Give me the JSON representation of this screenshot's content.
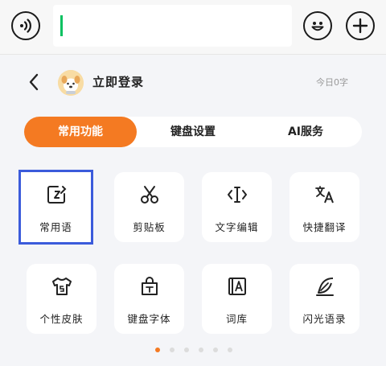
{
  "input": {
    "value": ""
  },
  "header": {
    "login_label": "立即登录",
    "today_count": "今日0字"
  },
  "tabs": [
    {
      "label": "常用功能",
      "active": true
    },
    {
      "label": "键盘设置",
      "active": false
    },
    {
      "label": "AI服务",
      "active": false
    }
  ],
  "features": [
    {
      "label": "常用语",
      "icon": "edit-note-icon",
      "selected": true
    },
    {
      "label": "剪贴板",
      "icon": "scissors-icon",
      "selected": false
    },
    {
      "label": "文字编辑",
      "icon": "text-cursor-icon",
      "selected": false
    },
    {
      "label": "快捷翻译",
      "icon": "translate-icon",
      "selected": false
    },
    {
      "label": "个性皮肤",
      "icon": "tshirt-icon",
      "selected": false
    },
    {
      "label": "键盘字体",
      "icon": "font-bag-icon",
      "selected": false
    },
    {
      "label": "词库",
      "icon": "dictionary-icon",
      "selected": false
    },
    {
      "label": "闪光语录",
      "icon": "feather-icon",
      "selected": false
    }
  ],
  "pager": {
    "pages": 6,
    "current": 1
  },
  "colors": {
    "accent": "#f47a22",
    "caret": "#07c160",
    "selection": "#3b5bdb"
  }
}
